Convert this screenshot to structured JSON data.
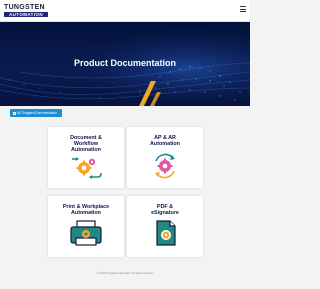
{
  "header": {
    "logo_top": "TUNGSTEN",
    "logo_bottom": "AUTOMATION",
    "menu_icon": "hamburger-menu-icon"
  },
  "hero": {
    "title": "Product Documentation",
    "colors": {
      "background": "#0a1c52",
      "accent": "#f5a623"
    }
  },
  "all_products_button": {
    "label": "All Tungsten Documentation",
    "icon": "grid-icon",
    "color": "#1a8fd6"
  },
  "cards": [
    {
      "title_lines": [
        "Document &",
        "Workflow",
        "Automation"
      ],
      "icon": "gears-arrows-icon"
    },
    {
      "title_lines": [
        "AP & AR",
        "Automation"
      ],
      "icon": "gear-cycle-icon"
    },
    {
      "title_lines": [
        "Print & Workplace",
        "Automation"
      ],
      "icon": "printer-gear-icon"
    },
    {
      "title_lines": [
        "PDF &",
        "eSignature"
      ],
      "icon": "document-gear-icon"
    }
  ],
  "colors": {
    "icon_teal": "#1f8a84",
    "icon_orange": "#f5a623",
    "icon_pink": "#e05b9b",
    "title_navy": "#12174a"
  },
  "footer": {
    "text": "© 2024 Tungsten Automation. All rights reserved."
  }
}
